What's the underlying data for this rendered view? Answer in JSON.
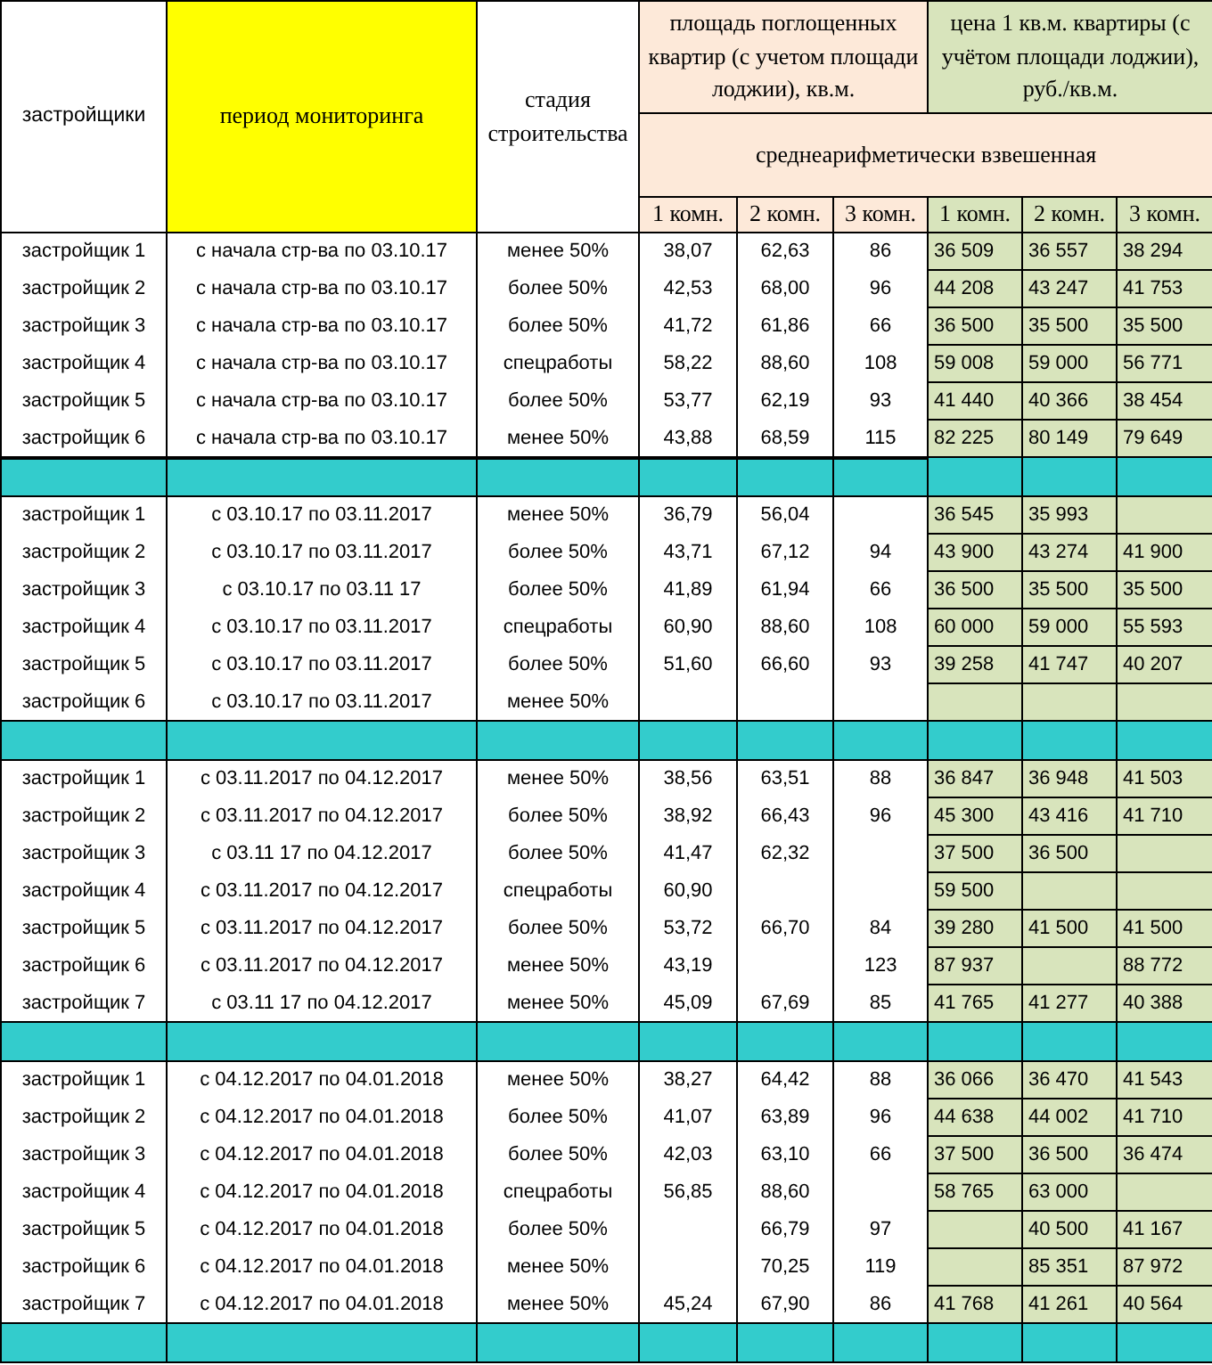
{
  "table": {
    "header": {
      "developer": "застройщики",
      "period": "период мониторинга",
      "stage": "стадия строительства",
      "area_group": "площадь поглощенных квартир (с учетом площади лоджии), кв.м.",
      "price_group": "цена 1 кв.м. квартиры (с учётом площади лоджии), руб./кв.м.",
      "subheader": "среднеарифметически взвешенная",
      "area_columns": [
        "1 комн.",
        "2 комн.",
        "3 комн."
      ],
      "price_columns": [
        "1 комн.",
        "2 комн.",
        "3 комн."
      ]
    },
    "groups": [
      {
        "rows": [
          [
            "застройщик 1",
            "с начала стр-ва по 03.10.17",
            "менее 50%",
            "38,07",
            "62,63",
            "86",
            "36 509",
            "36 557",
            "38 294"
          ],
          [
            "застройщик 2",
            "с начала стр-ва по 03.10.17",
            "более 50%",
            "42,53",
            "68,00",
            "96",
            "44 208",
            "43 247",
            "41 753"
          ],
          [
            "застройщик 3",
            "с начала стр-ва по 03.10.17",
            "более 50%",
            "41,72",
            "61,86",
            "66",
            "36 500",
            "35 500",
            "35 500"
          ],
          [
            "застройщик 4",
            "с начала стр-ва по 03.10.17",
            "спецработы",
            "58,22",
            "88,60",
            "108",
            "59 008",
            "59 000",
            "56 771"
          ],
          [
            "застройщик 5",
            "с начала стр-ва по 03.10.17",
            "более 50%",
            "53,77",
            "62,19",
            "93",
            "41 440",
            "40 366",
            "38 454"
          ],
          [
            "застройщик 6",
            "с начала стр-ва по 03.10.17",
            "менее 50%",
            "43,88",
            "68,59",
            "115",
            "82 225",
            "80 149",
            "79 649"
          ]
        ]
      },
      {
        "rows": [
          [
            "застройщик 1",
            "с 03.10.17 по 03.11.2017",
            "менее 50%",
            "36,79",
            "56,04",
            null,
            "36 545",
            "35 993",
            null
          ],
          [
            "застройщик 2",
            "с 03.10.17 по 03.11.2017",
            "более 50%",
            "43,71",
            "67,12",
            "94",
            "43 900",
            "43 274",
            "41 900"
          ],
          [
            "застройщик 3",
            "с 03.10.17 по 03.11 17",
            "более 50%",
            "41,89",
            "61,94",
            "66",
            "36 500",
            "35 500",
            "35 500"
          ],
          [
            "застройщик 4",
            "с 03.10.17 по 03.11.2017",
            "спецработы",
            "60,90",
            "88,60",
            "108",
            "60 000",
            "59 000",
            "55 593"
          ],
          [
            "застройщик 5",
            "с 03.10.17 по 03.11.2017",
            "более 50%",
            "51,60",
            "66,60",
            "93",
            "39 258",
            "41 747",
            "40 207"
          ],
          [
            "застройщик 6",
            "с 03.10.17 по 03.11.2017",
            "менее 50%",
            null,
            null,
            null,
            null,
            null,
            null
          ]
        ]
      },
      {
        "rows": [
          [
            "застройщик 1",
            "с 03.11.2017 по 04.12.2017",
            "менее 50%",
            "38,56",
            "63,51",
            "88",
            "36 847",
            "36 948",
            "41 503"
          ],
          [
            "застройщик 2",
            "с 03.11.2017 по 04.12.2017",
            "более 50%",
            "38,92",
            "66,43",
            "96",
            "45 300",
            "43 416",
            "41 710"
          ],
          [
            "застройщик 3",
            "с 03.11 17 по 04.12.2017",
            "более 50%",
            "41,47",
            "62,32",
            null,
            "37 500",
            "36 500",
            null
          ],
          [
            "застройщик 4",
            "с 03.11.2017 по 04.12.2017",
            "спецработы",
            "60,90",
            null,
            null,
            "59 500",
            null,
            null
          ],
          [
            "застройщик 5",
            "с 03.11.2017 по 04.12.2017",
            "более 50%",
            "53,72",
            "66,70",
            "84",
            "39 280",
            "41 500",
            "41 500"
          ],
          [
            "застройщик 6",
            "с 03.11.2017 по 04.12.2017",
            "менее 50%",
            "43,19",
            null,
            "123",
            "87 937",
            null,
            "88 772"
          ],
          [
            "застройщик 7",
            "с 03.11 17 по 04.12.2017",
            "менее 50%",
            "45,09",
            "67,69",
            "85",
            "41 765",
            "41 277",
            "40 388"
          ]
        ]
      },
      {
        "rows": [
          [
            "застройщик 1",
            "с 04.12.2017 по 04.01.2018",
            "менее 50%",
            "38,27",
            "64,42",
            "88",
            "36 066",
            "36 470",
            "41 543"
          ],
          [
            "застройщик 2",
            "с 04.12.2017 по 04.01.2018",
            "более 50%",
            "41,07",
            "63,89",
            "96",
            "44 638",
            "44 002",
            "41 710"
          ],
          [
            "застройщик 3",
            "с 04.12.2017 по 04.01.2018",
            "более 50%",
            "42,03",
            "63,10",
            "66",
            "37 500",
            "36 500",
            "36 474"
          ],
          [
            "застройщик 4",
            "с 04.12.2017 по 04.01.2018",
            "спецработы",
            "56,85",
            "88,60",
            null,
            "58 765",
            "63 000",
            null
          ],
          [
            "застройщик 5",
            "с 04.12.2017 по 04.01.2018",
            "более 50%",
            null,
            "66,79",
            "97",
            null,
            "40 500",
            "41 167"
          ],
          [
            "застройщик 6",
            "с 04.12.2017 по 04.01.2018",
            "менее 50%",
            null,
            "70,25",
            "119",
            null,
            "85 351",
            "87 972"
          ],
          [
            "застройщик 7",
            "с 04.12.2017 по 04.01.2018",
            "менее 50%",
            "45,24",
            "67,90",
            "86",
            "41 768",
            "41 261",
            "40 564"
          ]
        ]
      }
    ]
  }
}
